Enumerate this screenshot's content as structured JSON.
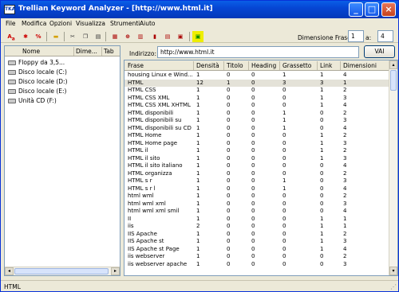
{
  "window": {
    "title": "Trellian Keyword Analyzer - [http://www.html.it]",
    "app_icon_text": "TKA"
  },
  "menu": [
    "File",
    "Modifica",
    "Opzioni",
    "Visualizza",
    "Strumenti",
    "Aiuto"
  ],
  "toolbar": {
    "icons": [
      "font-size-icon",
      "pin-icon",
      "percent-icon",
      "folder-open-icon",
      "cut-icon",
      "copy-icon",
      "paste-icon",
      "grid-icon",
      "target-icon",
      "columns-icon",
      "save-icon",
      "export-icon",
      "image-icon",
      "export-green-icon"
    ],
    "dimension_label": "Dimensione Frase:",
    "dimension_from": "1",
    "a_label": "a:",
    "dimension_to": "4"
  },
  "explorer": {
    "columns": [
      "Nome",
      "Dime...",
      "Tab"
    ],
    "drives": [
      "Floppy da 3,5...",
      "Disco locale (C:)",
      "Disco locale (D:)",
      "Disco locale (E:)",
      "Unità CD (F:)"
    ]
  },
  "address": {
    "label": "Indirizzo:",
    "value": "http://www.html.it",
    "go_label": "VAI"
  },
  "grid": {
    "columns": [
      "Frase",
      "Densità",
      "Titolo",
      "Heading",
      "Grassetto",
      "Link",
      "Dimensioni"
    ],
    "rows": [
      [
        "housing Linux e Wind...",
        "1",
        "0",
        "0",
        "1",
        "1",
        "4"
      ],
      [
        "HTML",
        "12",
        "1",
        "0",
        "3",
        "3",
        "1"
      ],
      [
        "HTML CSS",
        "1",
        "0",
        "0",
        "0",
        "1",
        "2"
      ],
      [
        "HTML CSS XML",
        "1",
        "0",
        "0",
        "0",
        "1",
        "3"
      ],
      [
        "HTML CSS XML XHTML",
        "1",
        "0",
        "0",
        "0",
        "1",
        "4"
      ],
      [
        "HTML disponibili",
        "1",
        "0",
        "0",
        "1",
        "0",
        "2"
      ],
      [
        "HTML disponibili su",
        "1",
        "0",
        "0",
        "1",
        "0",
        "3"
      ],
      [
        "HTML disponibili su CD",
        "1",
        "0",
        "0",
        "1",
        "0",
        "4"
      ],
      [
        "HTML Home",
        "1",
        "0",
        "0",
        "0",
        "1",
        "2"
      ],
      [
        "HTML Home page",
        "1",
        "0",
        "0",
        "0",
        "1",
        "3"
      ],
      [
        "HTML il",
        "1",
        "0",
        "0",
        "0",
        "1",
        "2"
      ],
      [
        "HTML il sito",
        "1",
        "0",
        "0",
        "0",
        "1",
        "3"
      ],
      [
        "HTML il sito italiano",
        "1",
        "0",
        "0",
        "0",
        "0",
        "4"
      ],
      [
        "HTML organizza",
        "1",
        "0",
        "0",
        "0",
        "0",
        "2"
      ],
      [
        "HTML s r",
        "1",
        "0",
        "0",
        "1",
        "0",
        "3"
      ],
      [
        "HTML s r l",
        "1",
        "0",
        "0",
        "1",
        "0",
        "4"
      ],
      [
        "html wml",
        "1",
        "0",
        "0",
        "0",
        "0",
        "2"
      ],
      [
        "html wml xml",
        "1",
        "0",
        "0",
        "0",
        "0",
        "3"
      ],
      [
        "html wml xml smil",
        "1",
        "0",
        "0",
        "0",
        "0",
        "4"
      ],
      [
        "II",
        "1",
        "0",
        "0",
        "0",
        "1",
        "1"
      ],
      [
        "iis",
        "2",
        "0",
        "0",
        "0",
        "1",
        "1"
      ],
      [
        "IIS Apache",
        "1",
        "0",
        "0",
        "0",
        "1",
        "2"
      ],
      [
        "IIS Apache st",
        "1",
        "0",
        "0",
        "0",
        "1",
        "3"
      ],
      [
        "IIS Apache st Page",
        "1",
        "0",
        "0",
        "0",
        "1",
        "4"
      ],
      [
        "iis webserver",
        "1",
        "0",
        "0",
        "0",
        "0",
        "2"
      ],
      [
        "iis webserver apache",
        "1",
        "0",
        "0",
        "0",
        "0",
        "3"
      ]
    ],
    "selected_row": 1
  },
  "status": {
    "text": "HTML"
  }
}
